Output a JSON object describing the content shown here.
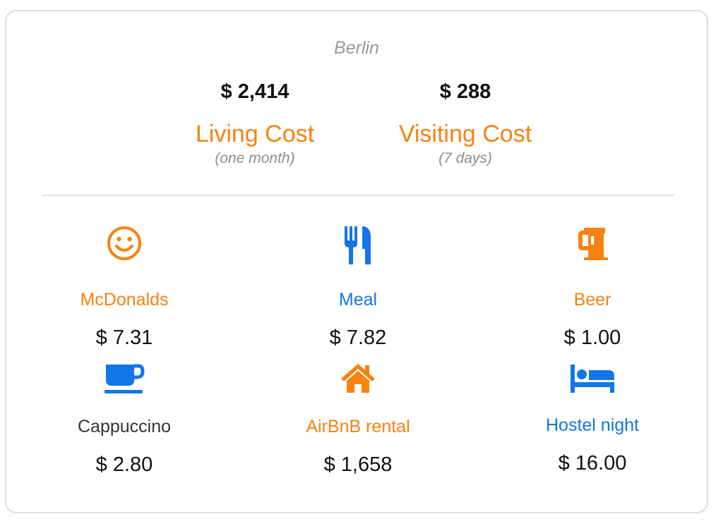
{
  "city": "Berlin",
  "summary": {
    "living": {
      "amount": "$ 2,414",
      "label": "Living Cost",
      "period": "(one month)"
    },
    "visiting": {
      "amount": "$ 288",
      "label": "Visiting Cost",
      "period": "(7 days)"
    }
  },
  "colors": {
    "orange": "#f7820f",
    "blue": "#1276e8",
    "dark": "#333333",
    "muted": "#9a9a9a"
  },
  "items": [
    {
      "name": "McDonalds",
      "price": "$ 7.31",
      "icon": "smiley-icon",
      "color": "orange"
    },
    {
      "name": "Meal",
      "price": "$ 7.82",
      "icon": "fork-knife-icon",
      "color": "blue"
    },
    {
      "name": "Beer",
      "price": "$ 1.00",
      "icon": "beer-mug-icon",
      "color": "orange"
    },
    {
      "name": "Cappuccino",
      "price": "$ 2.80",
      "icon": "coffee-cup-icon",
      "color": "blue"
    },
    {
      "name": "AirBnB rental",
      "price": "$ 1,658",
      "icon": "house-icon",
      "color": "orange"
    },
    {
      "name": "Hostel night",
      "price": "$ 16.00",
      "icon": "bed-icon",
      "color": "blue"
    }
  ]
}
